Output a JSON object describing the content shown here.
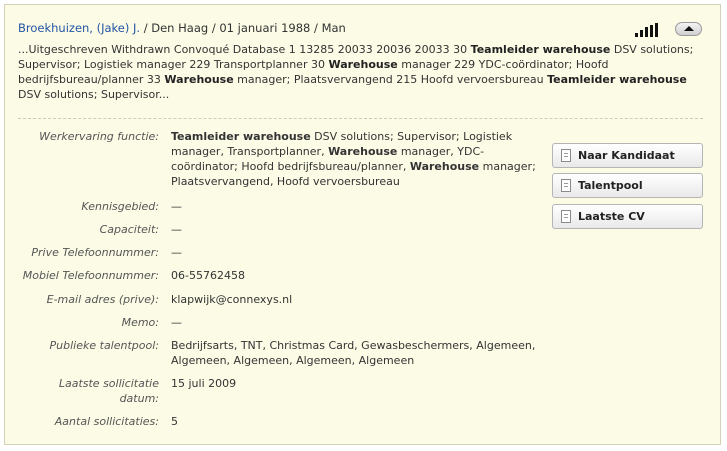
{
  "header": {
    "name": "Broekhuizen, (Jake) J.",
    "separator": "/",
    "city": "Den Haag",
    "birthdate": "01 januari 1988",
    "gender": "Man"
  },
  "snippet": [
    {
      "text": "...Uitgeschreven Withdrawn Convoqué Database 1 13285 20033 20036 20033 30 ",
      "bold": false
    },
    {
      "text": "Teamleider warehouse",
      "bold": true
    },
    {
      "text": " DSV solutions; Supervisor; Logistiek manager 229 Transportplanner 30 ",
      "bold": false
    },
    {
      "text": "Warehouse",
      "bold": true
    },
    {
      "text": " manager 229 YDC-coördinator; Hoofd bedrijfsbureau/planner 33 ",
      "bold": false
    },
    {
      "text": "Warehouse",
      "bold": true
    },
    {
      "text": " manager; Plaatsvervangend 215 Hoofd vervoersbureau ",
      "bold": false
    },
    {
      "text": "Teamleider warehouse",
      "bold": true
    },
    {
      "text": " DSV solutions; Supervisor...",
      "bold": false
    }
  ],
  "fields": {
    "werkervaring": {
      "label": "Werkervaring functie:",
      "value": [
        {
          "text": "Teamleider warehouse",
          "bold": true
        },
        {
          "text": " DSV solutions; Supervisor; Logistiek manager, Transportplanner, ",
          "bold": false
        },
        {
          "text": "Warehouse",
          "bold": true
        },
        {
          "text": " manager, YDC-coördinator; Hoofd bedrijfsbureau/planner, ",
          "bold": false
        },
        {
          "text": "Warehouse",
          "bold": true
        },
        {
          "text": " manager; Plaatsvervangend, Hoofd vervoersbureau",
          "bold": false
        }
      ]
    },
    "kennisgebied": {
      "label": "Kennisgebied:",
      "value": "—"
    },
    "capaciteit": {
      "label": "Capaciteit:",
      "value": "—"
    },
    "prive_telefoon": {
      "label": "Prive Telefoonnummer:",
      "value": "—"
    },
    "mobiel_telefoon": {
      "label": "Mobiel Telefoonnummer:",
      "value": "06-55762458"
    },
    "email": {
      "label": "E-mail adres (prive):",
      "value": "klapwijk@connexys.nl"
    },
    "memo": {
      "label": "Memo:",
      "value": "—"
    },
    "talentpool": {
      "label": "Publieke talentpool:",
      "value": "Bedrijfsarts, TNT, Christmas Card, Gewasbeschermers, Algemeen, Algemeen, Algemeen, Algemeen, Algemeen"
    },
    "laatste_sollicitatie": {
      "label": "Laatste sollicitatie datum:",
      "value": "15 juli 2009"
    },
    "aantal_sollicitaties": {
      "label": "Aantal sollicitaties:",
      "value": "5"
    }
  },
  "actions": {
    "naar_kandidaat": "Naar Kandidaat",
    "talentpool": "Talentpool",
    "laatste_cv": "Laatste CV"
  },
  "icons": {
    "signal": "signal-strength-icon",
    "collapse": "collapse-up-icon",
    "document": "document-icon"
  },
  "colors": {
    "card_background": "#fcfbe6",
    "card_border": "#d3d1b8",
    "name_link": "#2255a4",
    "label_text": "#555555"
  }
}
